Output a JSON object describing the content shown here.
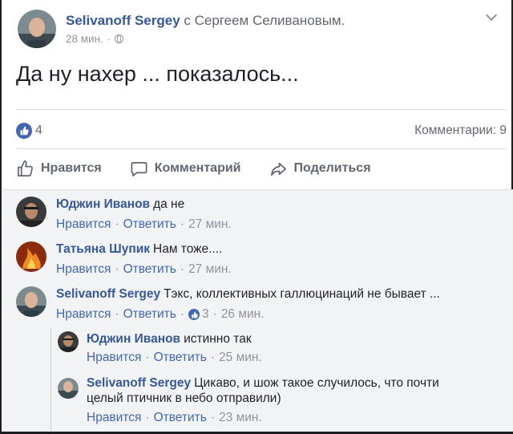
{
  "post": {
    "author": "Selivanoff Sergey",
    "with_text": "с Сергеем Селивановым.",
    "time": "28 мин.",
    "privacy_icon": "globe-icon",
    "text": "Да ну нахер ... показалось...",
    "likes": "4",
    "comments_count": "Комментарии: 9"
  },
  "actions": {
    "like": "Нравится",
    "comment": "Комментарий",
    "share": "Поделиться"
  },
  "comments": [
    {
      "name": "Юджин Иванов",
      "text": "да не",
      "like": "Нравится",
      "reply": "Ответить",
      "time": "27 мин."
    },
    {
      "name": "Татьяна Шупик",
      "text": "Нам тоже....",
      "like": "Нравится",
      "reply": "Ответить",
      "time": "27 мин."
    },
    {
      "name": "Selivanoff Sergey",
      "text": "Тэкс, коллективных галлюцинаций не бывает ...",
      "like": "Нравится",
      "reply": "Ответить",
      "reactions": "3",
      "time": "26 мин."
    }
  ],
  "replies": [
    {
      "name": "Юджин Иванов",
      "text": "истинно так",
      "like": "Нравится",
      "reply": "Ответить",
      "time": "25 мин."
    },
    {
      "name": "Selivanoff Sergey",
      "text": "Цикаво, и шож такое случилось, что почти",
      "text2": "целый птичник в небо отправили)",
      "like": "Нравится",
      "reply": "Ответить",
      "time": "23 мин."
    }
  ],
  "colors": {
    "link": "#365899",
    "accent": "#4267b2",
    "muted": "#90949c",
    "bg_comments": "#f2f3f5"
  }
}
